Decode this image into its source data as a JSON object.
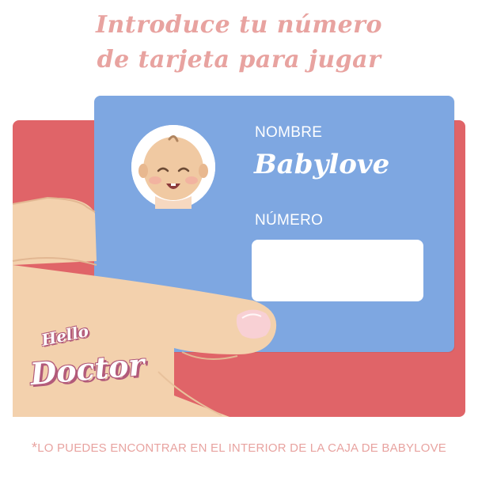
{
  "headline": {
    "line1": "Introduce tu número",
    "line2": "de tarjeta para jugar"
  },
  "card": {
    "name_label": "NOMBRE",
    "name_value": "Babylove",
    "number_label": "NÚMERO",
    "number_value": "",
    "avatar": "baby-face-icon"
  },
  "logo": {
    "line1": "Hello",
    "line2": "Doctor"
  },
  "footnote": {
    "marker": "*",
    "text": "LO PUEDES ENCONTRAR EN EL INTERIOR DE LA CAJA DE BABYLOVE"
  },
  "colors": {
    "headline": "#e8a3a0",
    "red_card": "#e06468",
    "blue_card": "#7ea7e1",
    "skin": "#f3d1ad",
    "text_white": "#ffffff"
  }
}
